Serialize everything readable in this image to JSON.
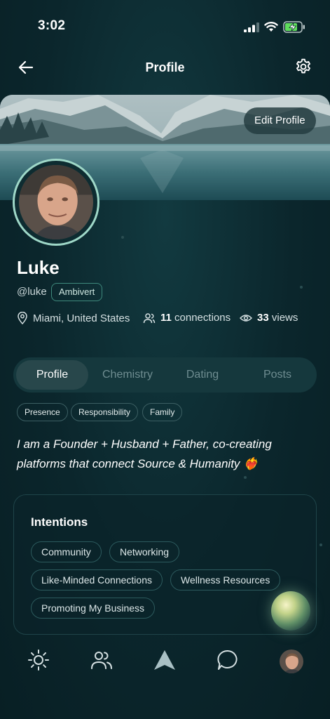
{
  "status_bar": {
    "time": "3:02"
  },
  "header": {
    "title": "Profile"
  },
  "cover": {
    "edit_profile_label": "Edit Profile"
  },
  "profile": {
    "name": "Luke",
    "handle": "@luke",
    "personality_badge": "Ambivert",
    "location": "Miami, United States",
    "connections_count": "11",
    "connections_label": "connections",
    "views_count": "33",
    "views_label": "views"
  },
  "tabs": [
    {
      "label": "Profile",
      "active": true
    },
    {
      "label": "Chemistry",
      "active": false
    },
    {
      "label": "Dating",
      "active": false
    },
    {
      "label": "Posts",
      "active": false
    }
  ],
  "values_chips": [
    "Presence",
    "Responsibility",
    "Family"
  ],
  "bio": "I am a Founder + Husband + Father, co-creating platforms that connect Source & Humanity ❤️‍🔥",
  "intentions": {
    "title": "Intentions",
    "items": [
      "Community",
      "Networking",
      "Like-Minded Connections",
      "Wellness Resources",
      "Promoting My Business"
    ]
  },
  "bottom_nav": {
    "items": [
      "sun-icon",
      "people-icon",
      "triangle-logo-icon",
      "chat-bubble-icon",
      "profile-avatar"
    ]
  },
  "colors": {
    "background": "#0b262c",
    "accent_ring": "#9fd8c8",
    "badge_border": "#3f8a7d",
    "tab_active": "#28474b",
    "tab_inactive_text": "#6f8d91"
  }
}
